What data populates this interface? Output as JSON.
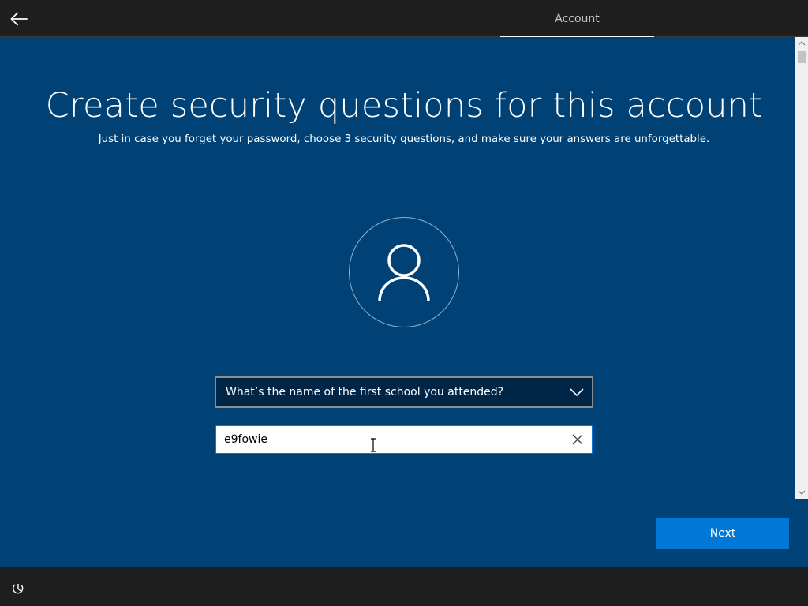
{
  "header": {
    "tab_label": "Account",
    "back_icon": "back-arrow-icon"
  },
  "main": {
    "title": "Create security questions for this account",
    "subtitle": "Just in case you forget your password, choose 3 security questions, and make sure your answers are unforgettable.",
    "avatar_icon": "user-icon",
    "question": {
      "selected": "What’s the name of the first school you attended?",
      "icon": "chevron-down-icon"
    },
    "answer": {
      "value": "e9fowie",
      "clear_icon": "close-icon"
    },
    "next_label": "Next"
  },
  "footer": {
    "ease_of_access_icon": "ease-of-access-icon"
  },
  "colors": {
    "background": "#004275",
    "bar": "#1f1f1f",
    "accent": "#0078d7",
    "select_bg": "#002647"
  }
}
